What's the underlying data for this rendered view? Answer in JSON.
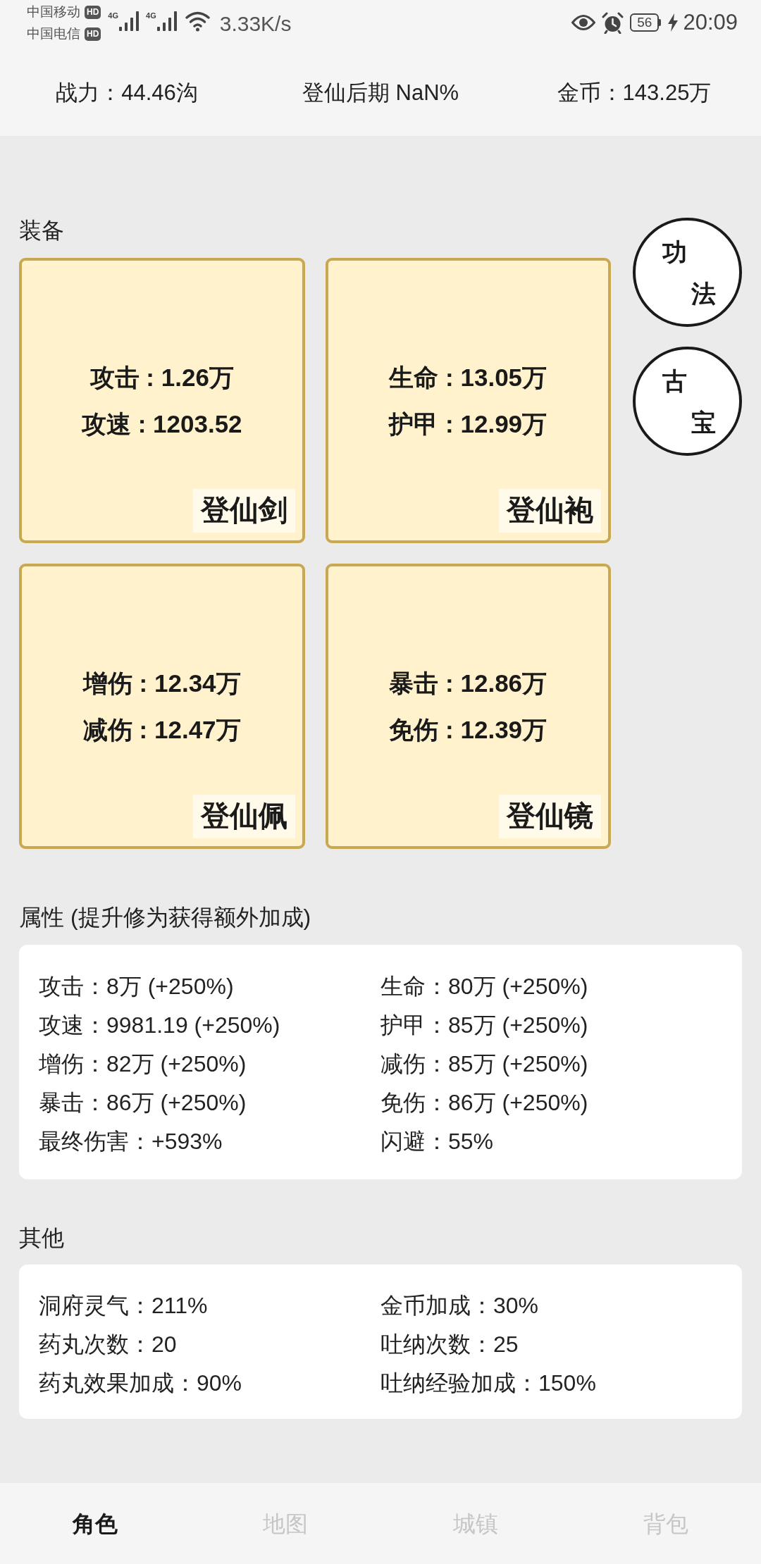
{
  "status_bar": {
    "carriers": [
      {
        "name": "中国移动",
        "badge": "HD"
      },
      {
        "name": "中国电信",
        "badge": "HD"
      }
    ],
    "signals": [
      {
        "label": "4G"
      },
      {
        "label": "4G"
      }
    ],
    "speed": "3.33K/s",
    "battery": "56",
    "time": "20:09"
  },
  "header": {
    "stats": [
      "战力：44.46沟",
      "登仙后期 NaN%",
      "金币：143.25万"
    ]
  },
  "equipment": {
    "title": "装备",
    "items": [
      {
        "name": "登仙剑",
        "stats": [
          "攻击 : 1.26万",
          "攻速 : 1203.52"
        ]
      },
      {
        "name": "登仙袍",
        "stats": [
          "生命 : 13.05万",
          "护甲 : 12.99万"
        ]
      },
      {
        "name": "登仙佩",
        "stats": [
          "增伤 : 12.34万",
          "减伤 : 12.47万"
        ]
      },
      {
        "name": "登仙镜",
        "stats": [
          "暴击 : 12.86万",
          "免伤 : 12.39万"
        ]
      }
    ],
    "side_buttons": [
      "功法",
      "古宝"
    ]
  },
  "attributes": {
    "title": "属性 (提升修为获得额外加成)",
    "items": [
      "攻击：8万 (+250%)",
      "生命：80万 (+250%)",
      "攻速：9981.19 (+250%)",
      "护甲：85万 (+250%)",
      "增伤：82万 (+250%)",
      "减伤：85万 (+250%)",
      "暴击：86万 (+250%)",
      "免伤：86万 (+250%)",
      "最终伤害：+593%",
      "闪避：55%"
    ]
  },
  "other": {
    "title": "其他",
    "items": [
      "洞府灵气：211%",
      "金币加成：30%",
      "药丸次数：20",
      "吐纳次数：25",
      "药丸效果加成：90%",
      "吐纳经验加成：150%"
    ]
  },
  "tabs": [
    {
      "label": "角色",
      "selected": true
    },
    {
      "label": "地图",
      "selected": false
    },
    {
      "label": "城镇",
      "selected": false
    },
    {
      "label": "背包",
      "selected": false
    }
  ]
}
